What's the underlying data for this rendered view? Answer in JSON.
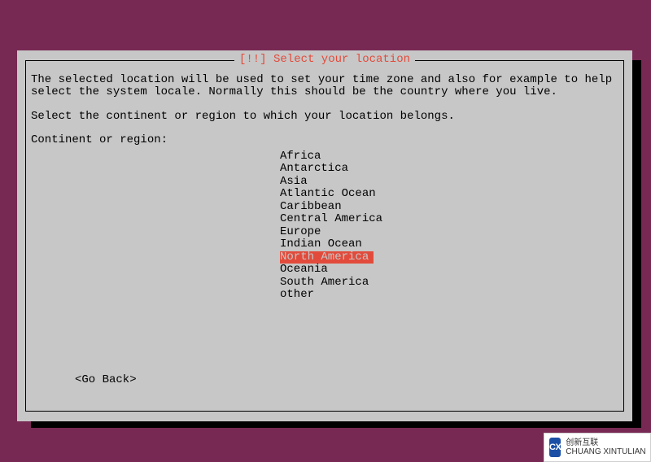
{
  "dialog": {
    "title": "[!!] Select your location",
    "paragraph1": "The selected location will be used to set your time zone and also for example to help\nselect the system locale. Normally this should be the country where you live.",
    "paragraph2": "Select the continent or region to which your location belongs.",
    "prompt": "Continent or region:",
    "regions": [
      "Africa",
      "Antarctica",
      "Asia",
      "Atlantic Ocean",
      "Caribbean",
      "Central America",
      "Europe",
      "Indian Ocean",
      "North America",
      "Oceania",
      "South America",
      "other"
    ],
    "selected_index": 8,
    "go_back": "<Go Back>"
  },
  "watermark": {
    "logo": "CX",
    "text": "创新互联\nCHUANG XINTULIAN"
  },
  "colors": {
    "background": "#772953",
    "panel": "#c7c7c7",
    "accent": "#e24b3b"
  }
}
